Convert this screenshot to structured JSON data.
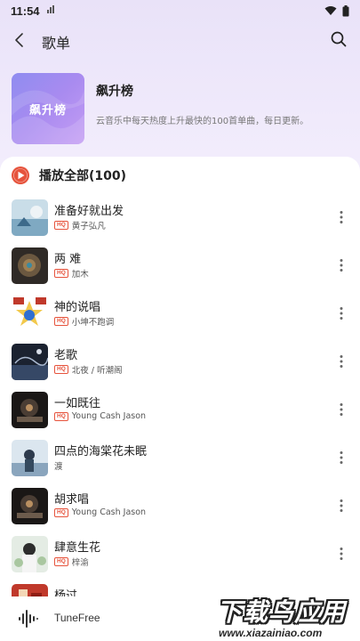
{
  "status": {
    "time": "11:54"
  },
  "header": {
    "title": "歌单"
  },
  "playlist": {
    "cover_text": "飙升榜",
    "name": "飙升榜",
    "description": "云音乐中每天热度上升最快的100首单曲，每日更新。"
  },
  "play_all": {
    "label": "播放全部(100)"
  },
  "songs": [
    {
      "title": "准备好就出发",
      "quality": "HQ",
      "artist": "黄子弘凡"
    },
    {
      "title": "两 难",
      "quality": "HQ",
      "artist": "加木"
    },
    {
      "title": "神的说唱",
      "quality": "HQ",
      "artist": "小坤不跑调"
    },
    {
      "title": "老歌",
      "quality": "HQ",
      "artist": "北夜 / 听潮阁"
    },
    {
      "title": "一如既往",
      "quality": "HQ",
      "artist": "Young Cash Jason"
    },
    {
      "title": "四点的海棠花未眠",
      "quality": "",
      "artist": "渡"
    },
    {
      "title": "胡求唱",
      "quality": "HQ",
      "artist": "Young Cash Jason"
    },
    {
      "title": "肆意生花",
      "quality": "HQ",
      "artist": "梓渝"
    },
    {
      "title": "杨过",
      "quality": "",
      "artist": ""
    }
  ],
  "player": {
    "app_name": "TuneFree"
  },
  "watermark": {
    "main": "下载鸟应用",
    "url": "www.xiazainiao.com"
  },
  "colors": {
    "accent": "#e6533c",
    "cover": "#a98bf0",
    "header_bg": "#ece5f9"
  }
}
